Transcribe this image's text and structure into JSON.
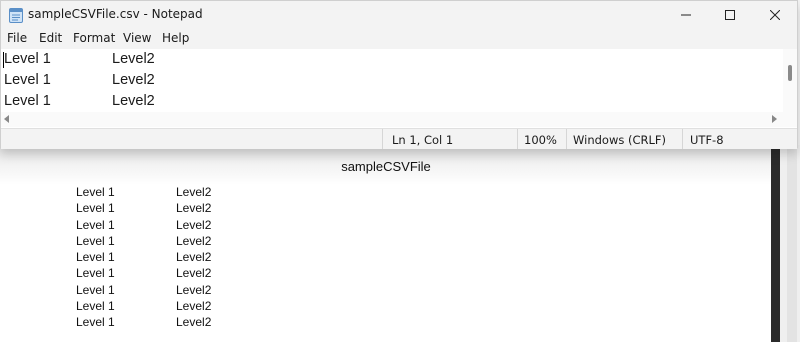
{
  "window": {
    "title": "sampleCSVFile.csv - Notepad",
    "icon": "notepad-icon"
  },
  "menu": [
    "File",
    "Edit",
    "Format",
    "View",
    "Help"
  ],
  "editor": {
    "rows": [
      [
        "Level 1",
        "Level2"
      ],
      [
        "Level 1",
        "Level2"
      ],
      [
        "Level 1",
        "Level2"
      ]
    ]
  },
  "status": {
    "position": "Ln 1, Col 1",
    "zoom": "100%",
    "line_ending": "Windows (CRLF)",
    "encoding": "UTF-8"
  },
  "preview": {
    "title": "sampleCSVFile",
    "rows": [
      [
        "Level 1",
        "Level2"
      ],
      [
        "Level 1",
        "Level2"
      ],
      [
        "Level 1",
        "Level2"
      ],
      [
        "Level 1",
        "Level2"
      ],
      [
        "Level 1",
        "Level2"
      ],
      [
        "Level 1",
        "Level2"
      ],
      [
        "Level 1",
        "Level2"
      ],
      [
        "Level 1",
        "Level2"
      ],
      [
        "Level 1",
        "Level2"
      ]
    ]
  }
}
